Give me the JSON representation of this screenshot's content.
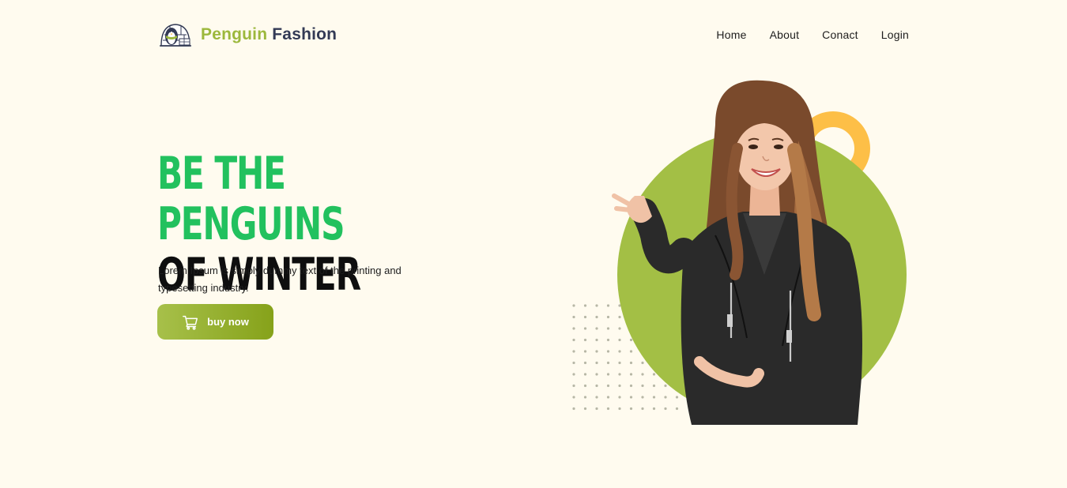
{
  "brand": {
    "name_part1": "Penguin",
    "name_part2": "Fashion",
    "logo_icon": "penguin-igloo-logo-icon"
  },
  "nav": {
    "items": [
      {
        "label": "Home"
      },
      {
        "label": "About"
      },
      {
        "label": "Conact"
      },
      {
        "label": "Login"
      }
    ]
  },
  "hero": {
    "title_line1": "BE THE PENGUINS",
    "title_line2": "OF WINTER",
    "description": "Lorem Ipsum is simply dummy text of the printing and typesetting industry.",
    "button_label": "buy now",
    "button_icon": "cart-icon"
  },
  "colors": {
    "background": "#fffbef",
    "accent_green": "#22c15e",
    "brand_olive": "#9cb83c",
    "brand_navy": "#333a55",
    "circle_green": "#a3bf45",
    "ring_yellow": "#fdbf47"
  }
}
